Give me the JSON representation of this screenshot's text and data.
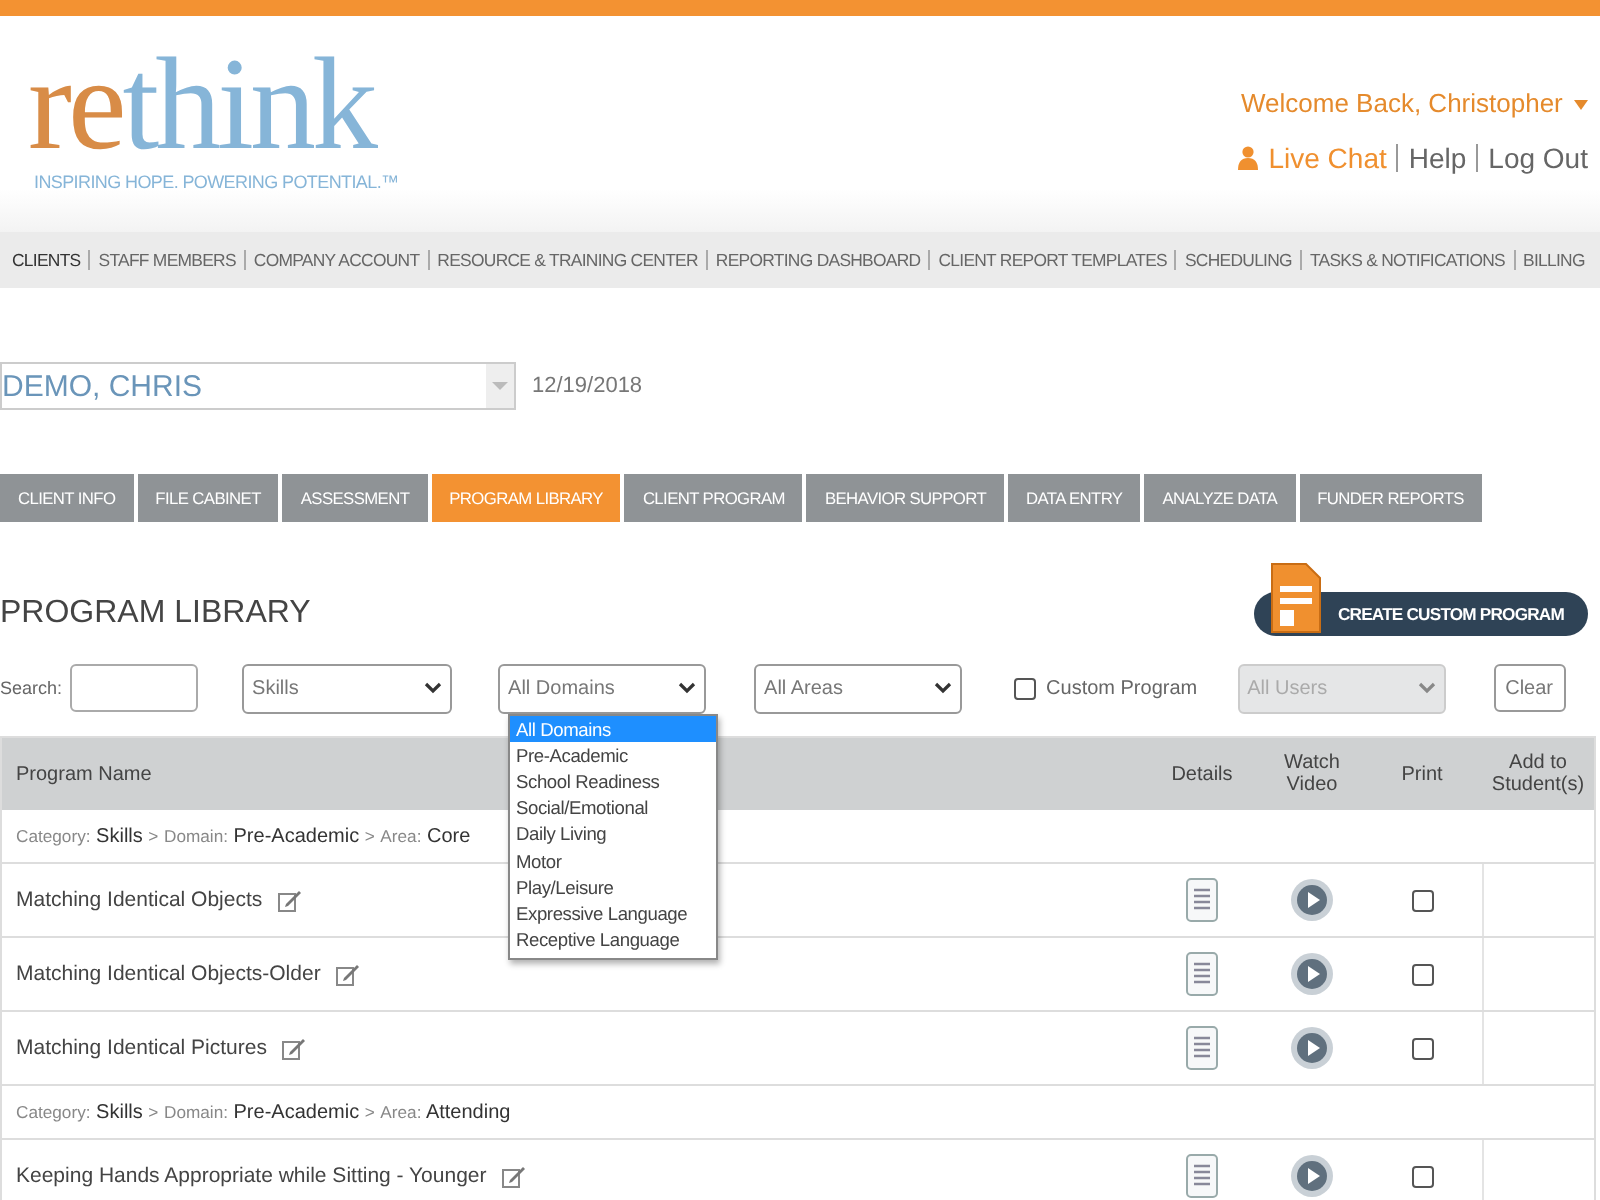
{
  "logo": {
    "re": "re",
    "think": "think",
    "tagline": "INSPIRING HOPE. POWERING POTENTIAL.™"
  },
  "user_menu": {
    "welcome": "Welcome Back, Christopher",
    "links": [
      {
        "kind": "chat",
        "label": "Live Chat"
      },
      {
        "kind": "plain",
        "label": "Help"
      },
      {
        "kind": "plain",
        "label": "Log Out"
      }
    ]
  },
  "nav": [
    {
      "label": "CLIENTS",
      "selected": true
    },
    {
      "label": "STAFF MEMBERS",
      "selected": false
    },
    {
      "label": "COMPANY ACCOUNT",
      "selected": false
    },
    {
      "label": "RESOURCE & TRAINING CENTER",
      "selected": false
    },
    {
      "label": "REPORTING DASHBOARD",
      "selected": false
    },
    {
      "label": "CLIENT REPORT TEMPLATES",
      "selected": false
    },
    {
      "label": "SCHEDULING",
      "selected": false
    },
    {
      "label": "TASKS & NOTIFICATIONS",
      "selected": false
    },
    {
      "label": "BILLING",
      "selected": false
    }
  ],
  "client": {
    "value": "DEMO, CHRIS",
    "date": "12/19/2018"
  },
  "tabs": [
    {
      "label": "CLIENT INFO",
      "selected": false
    },
    {
      "label": "FILE CABINET",
      "selected": false
    },
    {
      "label": "ASSESSMENT",
      "selected": false
    },
    {
      "label": "PROGRAM LIBRARY",
      "selected": true
    },
    {
      "label": "CLIENT PROGRAM",
      "selected": false
    },
    {
      "label": "BEHAVIOR SUPPORT",
      "selected": false
    },
    {
      "label": "DATA ENTRY",
      "selected": false
    },
    {
      "label": "ANALYZE DATA",
      "selected": false
    },
    {
      "label": "FUNDER REPORTS",
      "selected": false
    }
  ],
  "section_title": "PROGRAM LIBRARY",
  "create_button": "CREATE CUSTOM PROGRAM",
  "filters": {
    "search_label": "Search:",
    "skills": "Skills",
    "domains": "All Domains",
    "areas": "All Areas",
    "custom": {
      "label": "Custom Program",
      "checked": false
    },
    "users": {
      "value": "All Users",
      "disabled": true
    },
    "clear": "Clear"
  },
  "domain_options": [
    {
      "label": "All Domains",
      "selected": true
    },
    {
      "label": "Pre-Academic",
      "selected": false
    },
    {
      "label": "School Readiness",
      "selected": false
    },
    {
      "label": "Social/Emotional",
      "selected": false
    },
    {
      "label": "Daily Living",
      "selected": false
    },
    {
      "label": "Motor",
      "selected": false
    },
    {
      "label": "Play/Leisure",
      "selected": false
    },
    {
      "label": "Expressive Language",
      "selected": false
    },
    {
      "label": "Receptive Language",
      "selected": false
    }
  ],
  "table": {
    "columns": [
      "Program Name",
      "Details",
      "Watch Video",
      "Print",
      "Add to Student(s)"
    ],
    "rows": [
      {
        "kind": "category",
        "parts": [
          {
            "kind": "label",
            "text": "Category:"
          },
          {
            "kind": "value",
            "text": "Skills"
          },
          {
            "kind": "label",
            "text": ">"
          },
          {
            "kind": "label",
            "text": "Domain:"
          },
          {
            "kind": "value",
            "text": "Pre-Academic"
          },
          {
            "kind": "label",
            "text": ">"
          },
          {
            "kind": "label",
            "text": "Area:"
          },
          {
            "kind": "value",
            "text": "Core"
          }
        ]
      },
      {
        "kind": "program",
        "name": "Matching Identical Objects",
        "print": false
      },
      {
        "kind": "program",
        "name": "Matching Identical Objects-Older",
        "print": false
      },
      {
        "kind": "program",
        "name": "Matching Identical Pictures",
        "print": false
      },
      {
        "kind": "category",
        "parts": [
          {
            "kind": "label",
            "text": "Category:"
          },
          {
            "kind": "value",
            "text": "Skills"
          },
          {
            "kind": "label",
            "text": ">"
          },
          {
            "kind": "label",
            "text": "Domain:"
          },
          {
            "kind": "value",
            "text": "Pre-Academic"
          },
          {
            "kind": "label",
            "text": ">"
          },
          {
            "kind": "label",
            "text": "Area:"
          },
          {
            "kind": "value",
            "text": "Attending"
          }
        ]
      },
      {
        "kind": "program",
        "name": "Keeping Hands Appropriate while Sitting - Younger",
        "print": false
      }
    ]
  }
}
